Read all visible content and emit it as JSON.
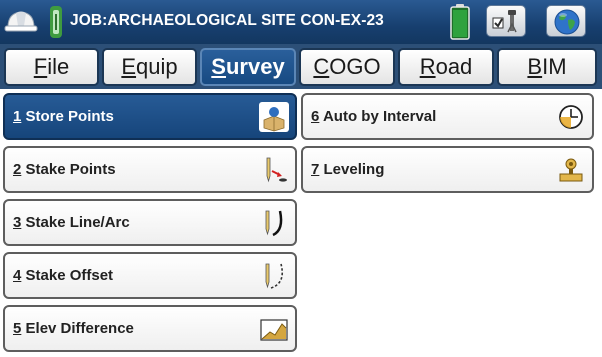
{
  "title_bar": {
    "job_title": "JOB:ARCHAEOLOGICAL SITE CON-EX-23",
    "icons": [
      "hard-hat-icon",
      "job-receiver-icon",
      "battery-icon",
      "instrument-settings-icon",
      "globe-icon"
    ]
  },
  "tabs": [
    {
      "label": "File",
      "key": "F"
    },
    {
      "label": "Equip",
      "key": "E"
    },
    {
      "label": "Survey",
      "key": "S",
      "active": true
    },
    {
      "label": "COGO",
      "key": "C"
    },
    {
      "label": "Road",
      "key": "R"
    },
    {
      "label": "BIM",
      "key": "B"
    }
  ],
  "menu": {
    "left": [
      {
        "num": "1",
        "label": "Store Points",
        "icon": "store-points-icon",
        "active": true
      },
      {
        "num": "2",
        "label": "Stake Points",
        "icon": "stake-points-icon"
      },
      {
        "num": "3",
        "label": "Stake Line/Arc",
        "icon": "stake-line-arc-icon"
      },
      {
        "num": "4",
        "label": "Stake Offset",
        "icon": "stake-offset-icon"
      },
      {
        "num": "5",
        "label": "Elev Difference",
        "icon": "elev-difference-icon"
      }
    ],
    "right": [
      {
        "num": "6",
        "label": "Auto by Interval",
        "icon": "clock-icon"
      },
      {
        "num": "7",
        "label": "Leveling",
        "icon": "leveling-icon"
      }
    ]
  },
  "colors": {
    "title_bar": "#173f6f",
    "active": "#1f5189",
    "tab_row": "#2c4f77"
  }
}
